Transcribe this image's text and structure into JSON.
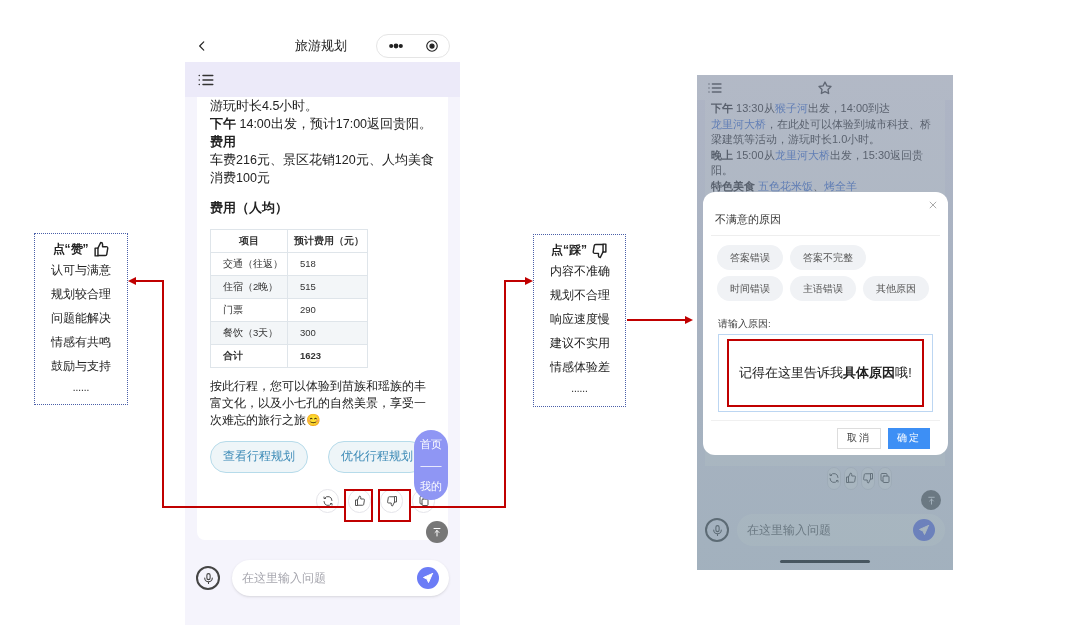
{
  "left_phone": {
    "title": "旅游规划",
    "paragraphs": [
      {
        "segments": [
          {
            "text": "游玩时长4.5小时。",
            "kind": "plain"
          }
        ]
      },
      {
        "segments": [
          {
            "text": "下午",
            "kind": "bold"
          },
          {
            "text": " 14:00出发，预计17:00返回贵阳。",
            "kind": "plain"
          }
        ]
      },
      {
        "segments": [
          {
            "text": "费用",
            "kind": "bold"
          }
        ]
      },
      {
        "segments": [
          {
            "text": "车费216元、景区花销120元、人均美食消费100元",
            "kind": "plain"
          }
        ]
      }
    ],
    "cost_heading": "费用（人均）",
    "table": {
      "columns": [
        "项目",
        "预计费用（元）"
      ],
      "rows": [
        {
          "cells": [
            "交通（往返）",
            "518"
          ],
          "total": false
        },
        {
          "cells": [
            "住宿（2晚）",
            "515"
          ],
          "total": false
        },
        {
          "cells": [
            "门票",
            "290"
          ],
          "total": false
        },
        {
          "cells": [
            "餐饮（3天）",
            "300"
          ],
          "total": false
        },
        {
          "cells": [
            "合计",
            "1623"
          ],
          "total": true
        }
      ]
    },
    "closing": "按此行程，您可以体验到苗族和瑶族的丰富文化，以及小七孔的自然美景，享受一次难忘的旅行之旅😊",
    "suggestions": [
      "查看行程规划",
      "优化行程规划"
    ],
    "float_nav": [
      "首页",
      "——",
      "我的"
    ],
    "input_placeholder": "在这里输入问题"
  },
  "like_note": {
    "heading": "点“赞”",
    "items": [
      "认可与满意",
      "规划较合理",
      "问题能解决",
      "情感有共鸣",
      "鼓励与支持"
    ],
    "more": "......"
  },
  "dislike_note": {
    "heading": "点“踩”",
    "items": [
      "内容不准确",
      "规划不合理",
      "响应速度慢",
      "建议不实用",
      "情感体验差"
    ],
    "more": "......"
  },
  "right_phone": {
    "paragraphs": [
      {
        "segments": [
          {
            "text": "下午",
            "kind": "bold"
          },
          {
            "text": " 13:30从",
            "kind": "plain"
          },
          {
            "text": "猴子河",
            "kind": "link"
          },
          {
            "text": "出发，14:00到达",
            "kind": "plain"
          },
          {
            "text": "龙里河大桥",
            "kind": "link"
          },
          {
            "text": "，在此处可以体验到城市科技、桥梁建筑等活动，游玩时长1.0小时。",
            "kind": "plain"
          }
        ]
      },
      {
        "segments": [
          {
            "text": "晚上",
            "kind": "bold"
          },
          {
            "text": " 15:00从",
            "kind": "plain"
          },
          {
            "text": "龙里河大桥",
            "kind": "link"
          },
          {
            "text": "出发，15:30返回贵阳。",
            "kind": "plain"
          }
        ]
      },
      {
        "segments": [
          {
            "text": "特色美食 ",
            "kind": "bold"
          },
          {
            "text": "五色花米饭",
            "kind": "link"
          },
          {
            "text": "、",
            "kind": "plain"
          },
          {
            "text": "烤全羊",
            "kind": "link"
          }
        ]
      }
    ],
    "dialog": {
      "title": "不满意的原因",
      "reasons": [
        "答案错误",
        "答案不完整",
        "时间错误",
        "主语错误",
        "其他原因"
      ],
      "input_label": "请输入原因:",
      "input_value": "记得在这里告诉我**具体原因**哦!",
      "buttons": [
        {
          "label": "取消",
          "kind": "secondary"
        },
        {
          "label": "确定",
          "kind": "primary"
        }
      ]
    },
    "input_placeholder": "在这里输入问题"
  }
}
